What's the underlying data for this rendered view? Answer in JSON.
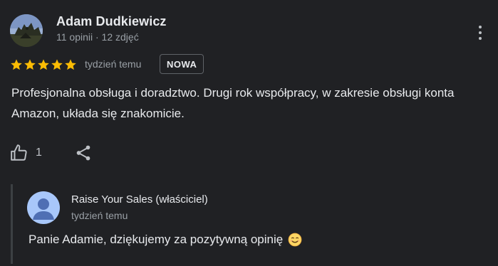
{
  "review": {
    "author": {
      "name": "Adam Dudkiewicz",
      "meta": "11 opinii · 12 zdjęć",
      "avatar_icon": "profile-photo-icon"
    },
    "rating": 5,
    "rating_max": 5,
    "star_color": "#fbbc04",
    "time": "tydzień temu",
    "badge": "NOWA",
    "text": "Profesjonalna obsługa i doradztwo. Drugi rok współpracy, w zakresie obsługi konta Amazon, układa się znakomicie.",
    "actions": {
      "like_icon": "thumb-up-icon",
      "like_count": "1",
      "share_icon": "share-icon",
      "more_icon": "more-vertical-icon"
    }
  },
  "owner_reply": {
    "name": "Raise Your Sales (właściciel)",
    "time": "tydzień temu",
    "text": "Panie Adamie, dziękujemy za pozytywną opinię",
    "emoji_icon": "smiling-face-icon",
    "avatar_color": "#a8c7fa",
    "avatar_icon": "default-person-icon"
  }
}
